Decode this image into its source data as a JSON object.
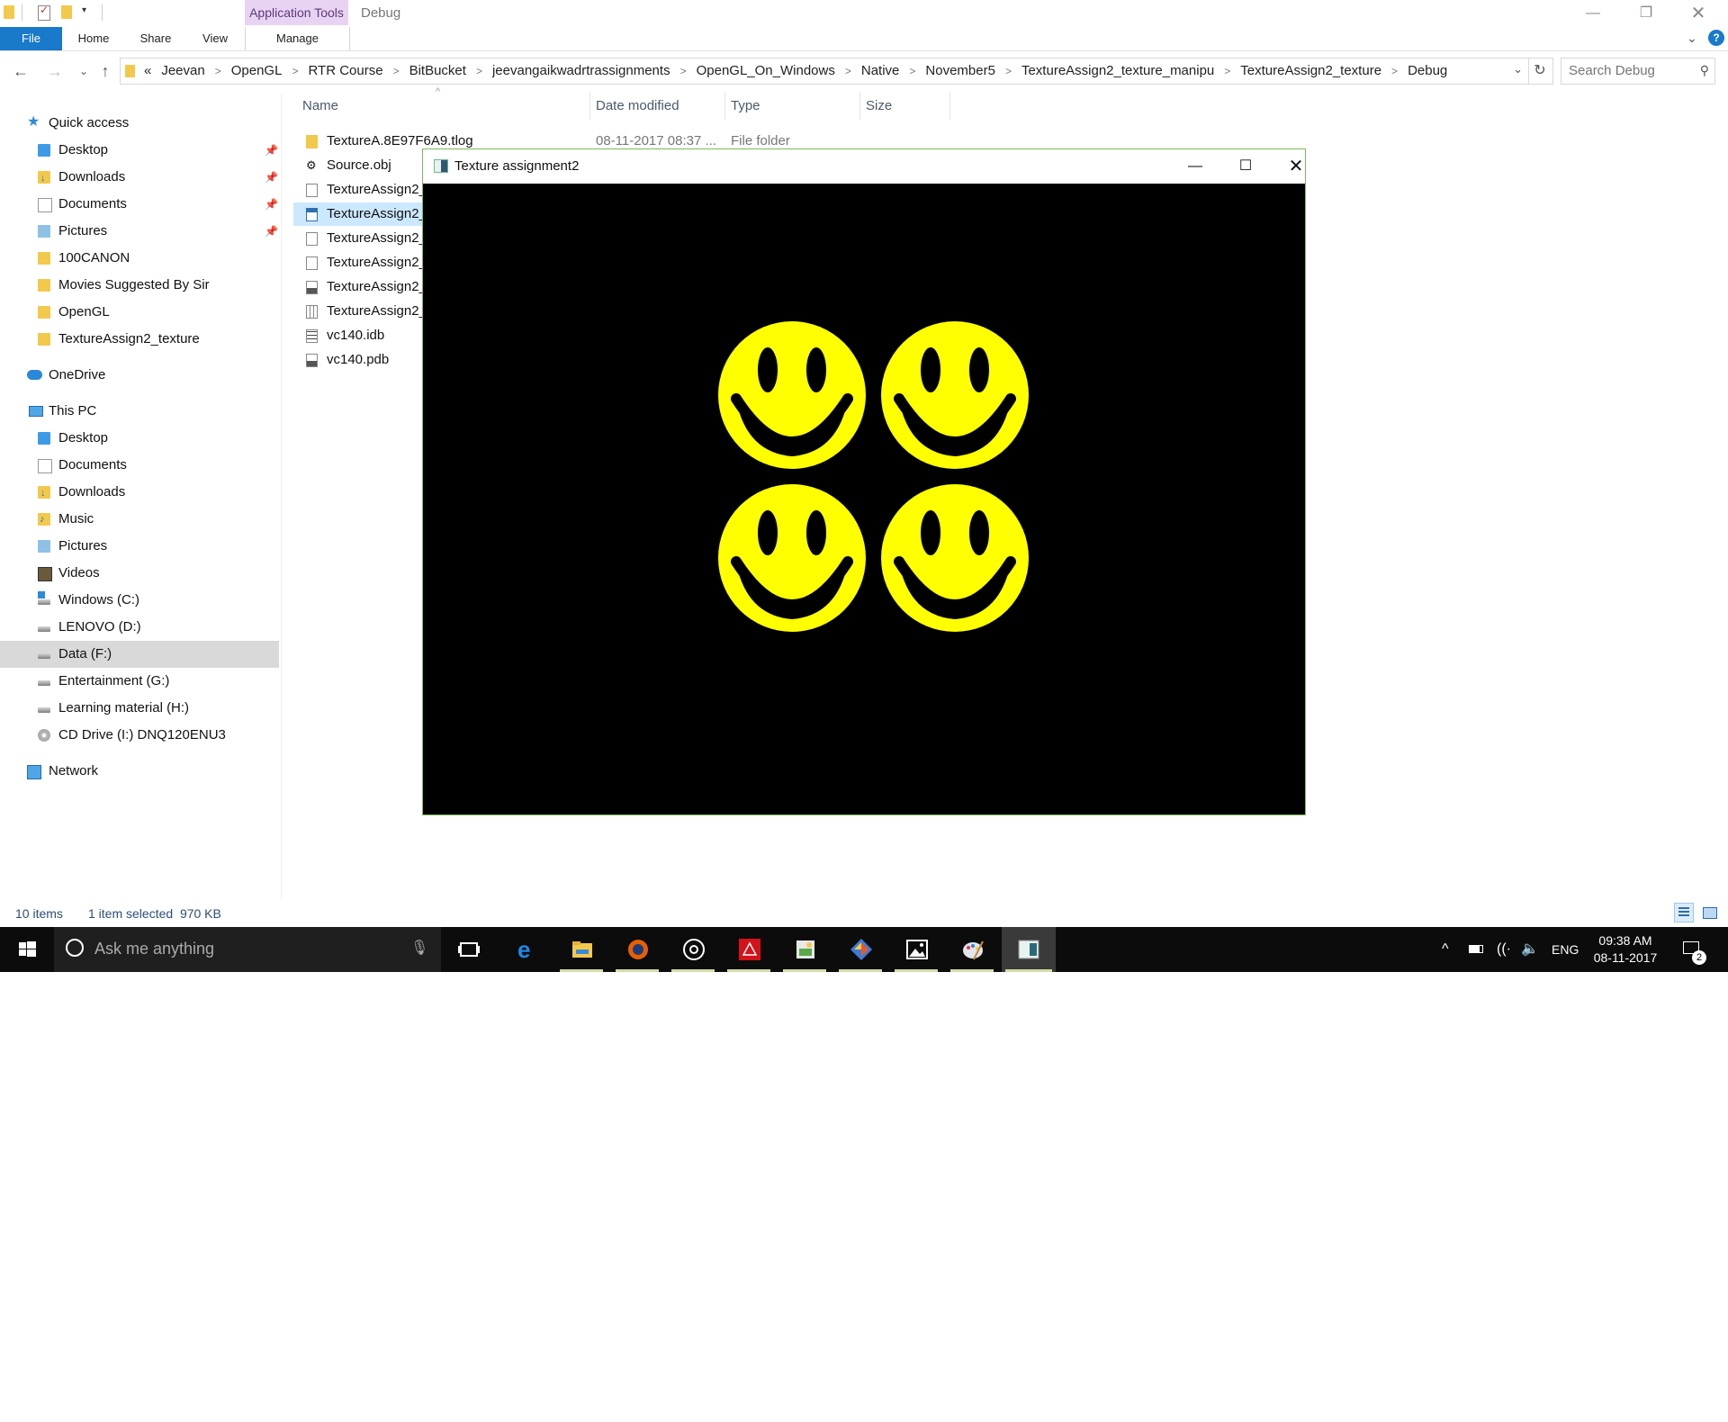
{
  "titlebar": {
    "context_tab": "Application Tools",
    "title": "Debug"
  },
  "ribbon": {
    "tabs": [
      "File",
      "Home",
      "Share",
      "View",
      "Manage"
    ]
  },
  "address": {
    "overflow": "«",
    "crumbs": [
      "Jeevan",
      "OpenGL",
      "RTR Course",
      "BitBucket",
      "jeevangaikwadrtrassignments",
      "OpenGL_On_Windows",
      "Native",
      "November5",
      "TextureAssign2_texture_manipu",
      "TextureAssign2_texture",
      "Debug"
    ],
    "search_placeholder": "Search Debug"
  },
  "nav": {
    "quick_access": "Quick access",
    "quick_items": [
      "Desktop",
      "Downloads",
      "Documents",
      "Pictures",
      "100CANON",
      "Movies Suggested By Sir",
      "OpenGL",
      "TextureAssign2_texture"
    ],
    "onedrive": "OneDrive",
    "this_pc": "This PC",
    "pc_items": [
      "Desktop",
      "Documents",
      "Downloads",
      "Music",
      "Pictures",
      "Videos",
      "Windows (C:)",
      "LENOVO (D:)",
      "Data (F:)",
      "Entertainment (G:)",
      "Learning material (H:)",
      "CD Drive (I:) DNQ120ENU3"
    ],
    "network": "Network"
  },
  "columns": [
    "Name",
    "Date modified",
    "Type",
    "Size"
  ],
  "files": [
    {
      "name": "TextureA.8E97F6A9.tlog",
      "date": "08-11-2017 08:37 ...",
      "type": "File folder"
    },
    {
      "name": "Source.obj",
      "date": "",
      "type": ""
    },
    {
      "name": "TextureAssign2_",
      "date": "",
      "type": ""
    },
    {
      "name": "TextureAssign2_",
      "date": "",
      "type": ""
    },
    {
      "name": "TextureAssign2_",
      "date": "",
      "type": ""
    },
    {
      "name": "TextureAssign2_",
      "date": "",
      "type": ""
    },
    {
      "name": "TextureAssign2_",
      "date": "",
      "type": ""
    },
    {
      "name": "TextureAssign2_",
      "date": "",
      "type": ""
    },
    {
      "name": "vc140.idb",
      "date": "",
      "type": ""
    },
    {
      "name": "vc140.pdb",
      "date": "",
      "type": ""
    }
  ],
  "status": {
    "items": "10 items",
    "selected": "1 item selected  970 KB"
  },
  "glwindow": {
    "title": "Texture assignment2",
    "face_color": "#ffff00",
    "face_count": 4
  },
  "taskbar": {
    "search_placeholder": "Ask me anything",
    "lang": "ENG",
    "time": "09:38 AM",
    "date": "08-11-2017",
    "notification_count": "2"
  },
  "colors": {
    "accent": "#1979ca",
    "context_tab": "#e8d3f3",
    "gl_border": "#7cbb59",
    "taskbar": "#0c0c0c"
  }
}
